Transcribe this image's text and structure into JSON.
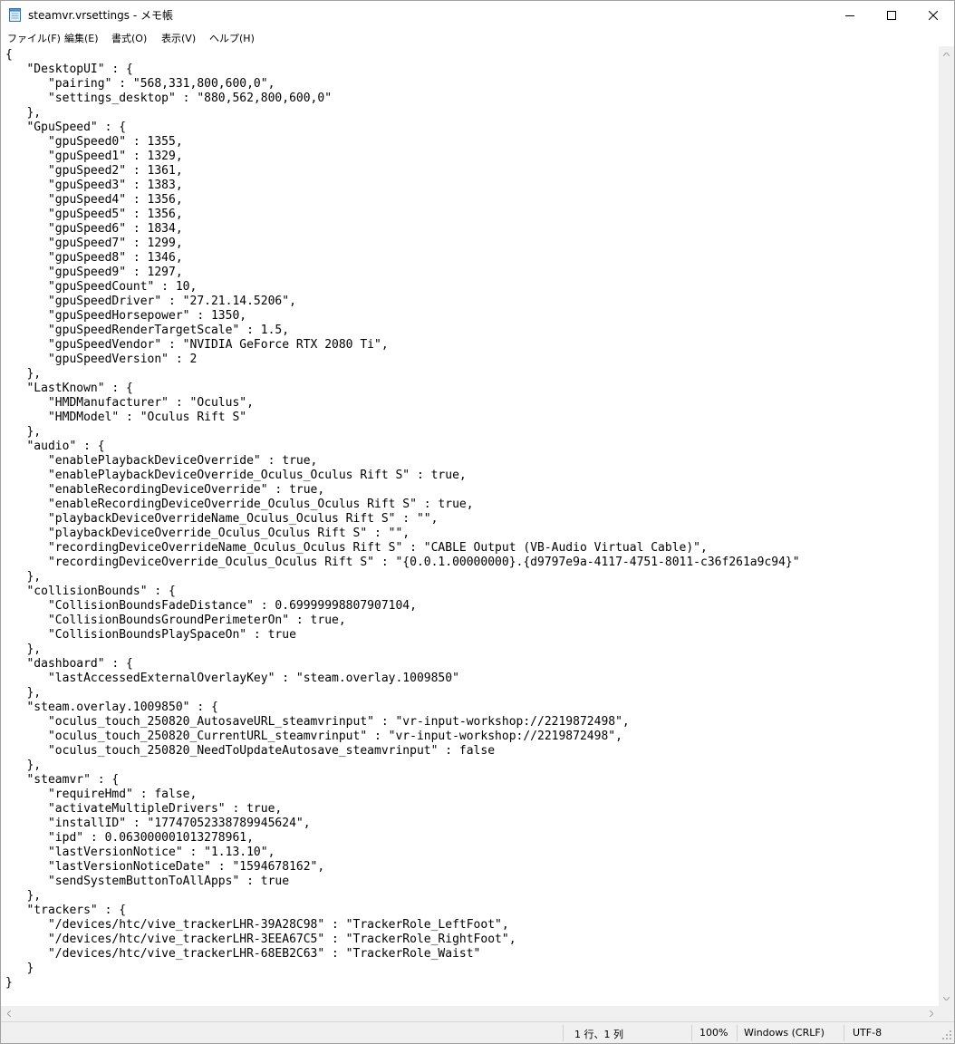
{
  "window": {
    "title": "steamvr.vrsettings - メモ帳",
    "controls": {
      "minimize_icon": "minimize-icon",
      "maximize_icon": "maximize-icon",
      "close_icon": "close-icon"
    }
  },
  "menu": {
    "items": [
      {
        "label": "ファイル(F)"
      },
      {
        "label": "編集(E)"
      },
      {
        "label": "書式(O)"
      },
      {
        "label": "表示(V)"
      },
      {
        "label": "ヘルプ(H)"
      }
    ]
  },
  "editor": {
    "lines": [
      "{",
      "   \"DesktopUI\" : {",
      "      \"pairing\" : \"568,331,800,600,0\",",
      "      \"settings_desktop\" : \"880,562,800,600,0\"",
      "   },",
      "   \"GpuSpeed\" : {",
      "      \"gpuSpeed0\" : 1355,",
      "      \"gpuSpeed1\" : 1329,",
      "      \"gpuSpeed2\" : 1361,",
      "      \"gpuSpeed3\" : 1383,",
      "      \"gpuSpeed4\" : 1356,",
      "      \"gpuSpeed5\" : 1356,",
      "      \"gpuSpeed6\" : 1834,",
      "      \"gpuSpeed7\" : 1299,",
      "      \"gpuSpeed8\" : 1346,",
      "      \"gpuSpeed9\" : 1297,",
      "      \"gpuSpeedCount\" : 10,",
      "      \"gpuSpeedDriver\" : \"27.21.14.5206\",",
      "      \"gpuSpeedHorsepower\" : 1350,",
      "      \"gpuSpeedRenderTargetScale\" : 1.5,",
      "      \"gpuSpeedVendor\" : \"NVIDIA GeForce RTX 2080 Ti\",",
      "      \"gpuSpeedVersion\" : 2",
      "   },",
      "   \"LastKnown\" : {",
      "      \"HMDManufacturer\" : \"Oculus\",",
      "      \"HMDModel\" : \"Oculus Rift S\"",
      "   },",
      "   \"audio\" : {",
      "      \"enablePlaybackDeviceOverride\" : true,",
      "      \"enablePlaybackDeviceOverride_Oculus_Oculus Rift S\" : true,",
      "      \"enableRecordingDeviceOverride\" : true,",
      "      \"enableRecordingDeviceOverride_Oculus_Oculus Rift S\" : true,",
      "      \"playbackDeviceOverrideName_Oculus_Oculus Rift S\" : \"\",",
      "      \"playbackDeviceOverride_Oculus_Oculus Rift S\" : \"\",",
      "      \"recordingDeviceOverrideName_Oculus_Oculus Rift S\" : \"CABLE Output (VB-Audio Virtual Cable)\",",
      "      \"recordingDeviceOverride_Oculus_Oculus Rift S\" : \"{0.0.1.00000000}.{d9797e9a-4117-4751-8011-c36f261a9c94}\"",
      "   },",
      "   \"collisionBounds\" : {",
      "      \"CollisionBoundsFadeDistance\" : 0.69999998807907104,",
      "      \"CollisionBoundsGroundPerimeterOn\" : true,",
      "      \"CollisionBoundsPlaySpaceOn\" : true",
      "   },",
      "   \"dashboard\" : {",
      "      \"lastAccessedExternalOverlayKey\" : \"steam.overlay.1009850\"",
      "   },",
      "   \"steam.overlay.1009850\" : {",
      "      \"oculus_touch_250820_AutosaveURL_steamvrinput\" : \"vr-input-workshop://2219872498\",",
      "      \"oculus_touch_250820_CurrentURL_steamvrinput\" : \"vr-input-workshop://2219872498\",",
      "      \"oculus_touch_250820_NeedToUpdateAutosave_steamvrinput\" : false",
      "   },",
      "   \"steamvr\" : {",
      "      \"requireHmd\" : false,",
      "      \"activateMultipleDrivers\" : true,",
      "      \"installID\" : \"17747052338789945624\",",
      "      \"ipd\" : 0.063000001013278961,",
      "      \"lastVersionNotice\" : \"1.13.10\",",
      "      \"lastVersionNoticeDate\" : \"1594678162\",",
      "      \"sendSystemButtonToAllApps\" : true",
      "   },",
      "   \"trackers\" : {",
      "      \"/devices/htc/vive_trackerLHR-39A28C98\" : \"TrackerRole_LeftFoot\",",
      "      \"/devices/htc/vive_trackerLHR-3EEA67C5\" : \"TrackerRole_RightFoot\",",
      "      \"/devices/htc/vive_trackerLHR-68EB2C63\" : \"TrackerRole_Waist\"",
      "   }",
      "}"
    ]
  },
  "statusbar": {
    "position": "1 行、1 列",
    "zoom": "100%",
    "line_ending": "Windows (CRLF)",
    "encoding": "UTF-8"
  }
}
